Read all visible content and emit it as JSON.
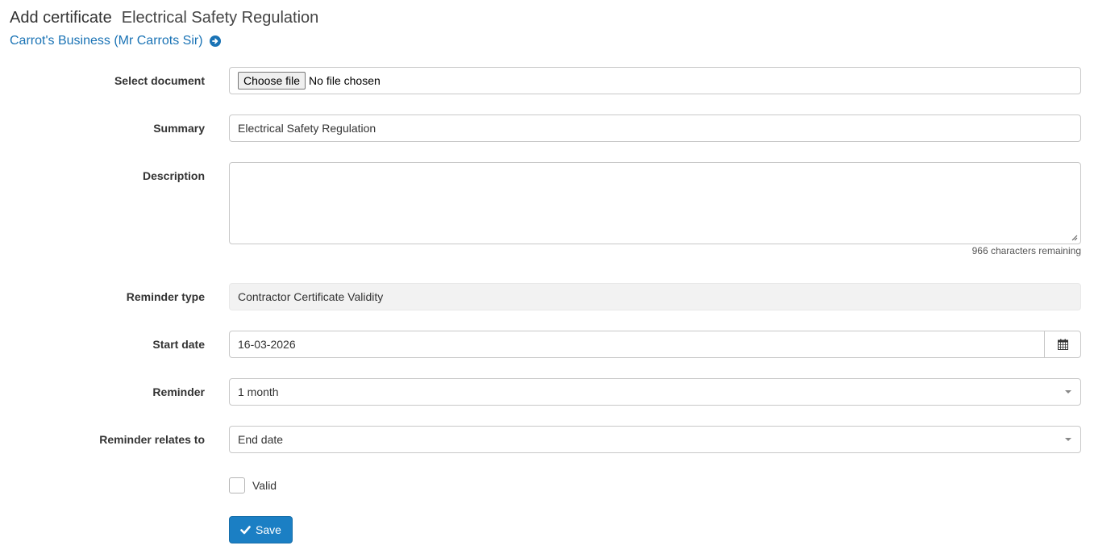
{
  "header": {
    "title": "Add certificate",
    "subtitle": "Electrical Safety Regulation",
    "business_link": "Carrot's Business (Mr Carrots Sir)",
    "business_icon": "arrow-circle-right-icon"
  },
  "form": {
    "select_document": {
      "label": "Select document",
      "button_label": "Choose file",
      "status_text": "No file chosen"
    },
    "summary": {
      "label": "Summary",
      "value": "Electrical Safety Regulation"
    },
    "description": {
      "label": "Description",
      "value": "",
      "counter": "966 characters remaining"
    },
    "reminder_type": {
      "label": "Reminder type",
      "value": "Contractor Certificate Validity"
    },
    "start_date": {
      "label": "Start date",
      "value": "16-03-2026",
      "icon": "calendar-icon"
    },
    "reminder": {
      "label": "Reminder",
      "value": "1 month"
    },
    "reminder_relates_to": {
      "label": "Reminder relates to",
      "value": "End date"
    },
    "valid": {
      "label": "Valid",
      "checked": false
    },
    "save": {
      "label": "Save",
      "icon": "check-icon"
    }
  },
  "colors": {
    "accent": "#1b7fc4",
    "link": "#1a73b5",
    "readonly_bg": "#f2f2f2"
  }
}
